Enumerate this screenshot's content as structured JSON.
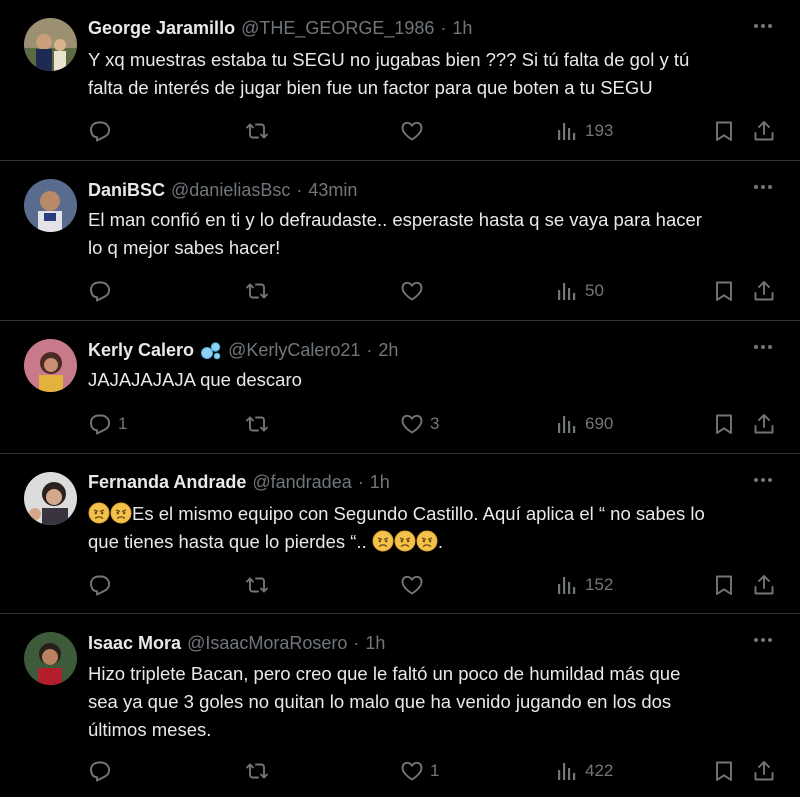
{
  "tweets": [
    {
      "name": "George Jaramillo",
      "handle": "@THE_GEORGE_1986",
      "time": "1h",
      "text_lines": [
        "Y xq muestras estaba tu SEGU no jugabas bien ??? Si tú falta de gol y tú",
        "falta de interés de jugar bien fue un factor para que boten a tu SEGU"
      ],
      "replies": "",
      "retweets": "",
      "likes": "",
      "views": "193"
    },
    {
      "name": "DaniBSC",
      "handle": "@danieliasBsc",
      "time": "43min",
      "text_lines": [
        "El man confió en ti y lo defraudaste.. esperaste hasta q se vaya para hacer",
        "lo q mejor sabes hacer!"
      ],
      "replies": "",
      "retweets": "",
      "likes": "",
      "views": "50"
    },
    {
      "name": "Kerly Calero",
      "name_emoji": "bubbles-emoji",
      "handle": "@KerlyCalero21",
      "time": "2h",
      "text_lines": [
        "JAJAJAJAJA que descaro"
      ],
      "replies": "1",
      "retweets": "",
      "likes": "3",
      "views": "690"
    },
    {
      "name": "Fernanda Andrade",
      "handle": "@fandradea",
      "time": "1h",
      "text_prefix_emoji": "disappointed-face-emoji",
      "text_line1": "Es el mismo equipo con Segundo Castillo. Aquí aplica el “ no sabes lo",
      "text_line2": "que tienes hasta que lo pierdes “..",
      "text_suffix": ".",
      "replies": "",
      "retweets": "",
      "likes": "",
      "views": "152"
    },
    {
      "name": "Isaac Mora",
      "handle": "@IsaacMoraRosero",
      "time": "1h",
      "text_lines": [
        "Hizo triplete Bacan, pero creo que le faltó un poco de humildad más que",
        "sea ya que 3 goles no quitan lo malo que ha venido jugando en los dos",
        "últimos  meses."
      ],
      "replies": "",
      "retweets": "",
      "likes": "1",
      "views": "422"
    }
  ],
  "separator": "·",
  "colors": {
    "background": "#000000",
    "text": "#e7e9ea",
    "muted": "#71767b",
    "border": "#2f3336"
  },
  "icons": [
    "more-icon",
    "reply-icon",
    "retweet-icon",
    "like-icon",
    "views-icon",
    "bookmark-icon",
    "share-icon"
  ]
}
